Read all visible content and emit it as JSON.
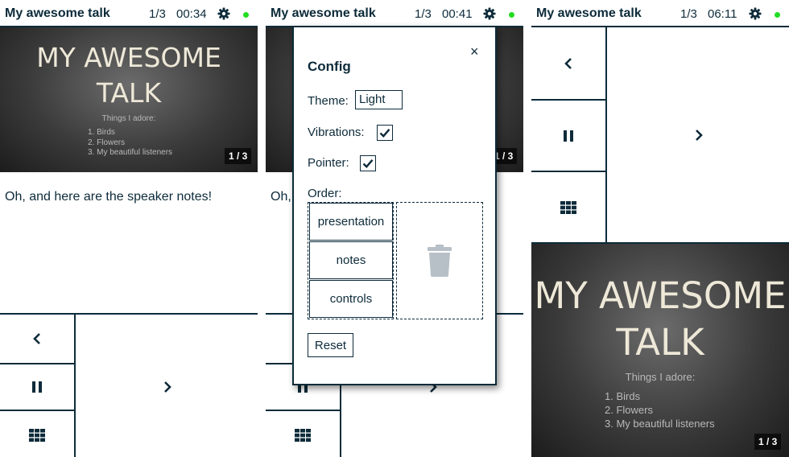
{
  "header": {
    "title": "My awesome talk",
    "counter": "1/3"
  },
  "panels": [
    {
      "time": "00:34"
    },
    {
      "time": "00:41"
    },
    {
      "time": "06:11"
    }
  ],
  "slide": {
    "title_line1": "MY AWESOME",
    "title_line2": "TALK",
    "subtitle": "Things I adore:",
    "items": [
      "1. Birds",
      "2. Flowers",
      "3. My beautiful listeners"
    ],
    "number": "1 / 3"
  },
  "notes": "Oh, and here are the speaker notes!",
  "config": {
    "title": "Config",
    "close": "×",
    "theme_label": "Theme:",
    "theme_value": "Light",
    "vibrations_label": "Vibrations:",
    "vibrations_checked": true,
    "pointer_label": "Pointer:",
    "pointer_checked": true,
    "order_label": "Order:",
    "order_items": [
      "presentation",
      "notes",
      "controls"
    ],
    "reset_label": "Reset"
  },
  "colors": {
    "primary": "#0d2b3a",
    "status_dot": "#22dd22",
    "trash": "#b7c0c7",
    "slide_text": "#eee8d8"
  },
  "icons": {
    "settings": "gear-icon",
    "status": "status-dot-icon",
    "previous": "chevron-left-icon",
    "next": "chevron-right-icon",
    "pause": "pause-icon",
    "grid": "grid-icon",
    "trash": "trash-icon",
    "check": "checkmark-icon"
  }
}
